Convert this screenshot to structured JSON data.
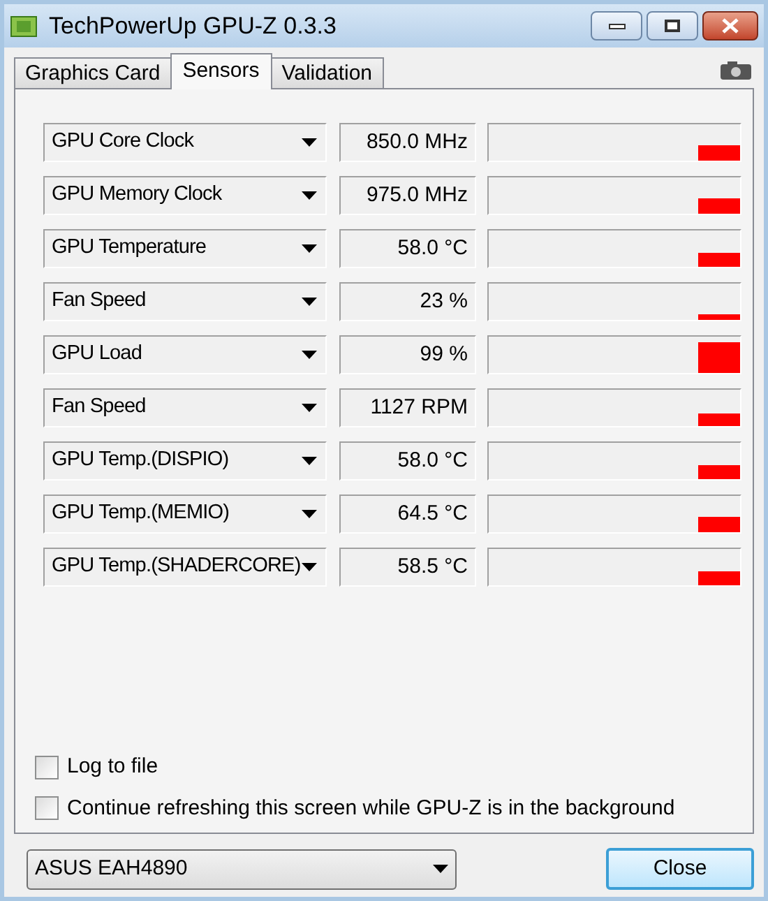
{
  "window": {
    "title": "TechPowerUp GPU-Z 0.3.3"
  },
  "tabs": [
    {
      "label": "Graphics Card",
      "selected": false
    },
    {
      "label": "Sensors",
      "selected": true
    },
    {
      "label": "Validation",
      "selected": false
    }
  ],
  "sensors": [
    {
      "name": "GPU Core Clock",
      "reading": "850.0 MHz"
    },
    {
      "name": "GPU Memory Clock",
      "reading": "975.0 MHz"
    },
    {
      "name": "GPU Temperature",
      "reading": "58.0 °C"
    },
    {
      "name": "Fan Speed",
      "reading": "23 %"
    },
    {
      "name": "GPU Load",
      "reading": "99 %"
    },
    {
      "name": "Fan Speed",
      "reading": "1127 RPM"
    },
    {
      "name": "GPU Temp.(DISPIO)",
      "reading": "58.0 °C"
    },
    {
      "name": "GPU Temp.(MEMIO)",
      "reading": "64.5 °C"
    },
    {
      "name": "GPU Temp.(SHADERCORE)",
      "reading": "58.5 °C"
    }
  ],
  "options": [
    {
      "label": "Log to file",
      "checked": false
    },
    {
      "label": "Continue refreshing this screen while GPU-Z is in the background",
      "checked": false
    }
  ],
  "card_select": {
    "value": "ASUS EAH4890"
  },
  "close_button": "Close"
}
